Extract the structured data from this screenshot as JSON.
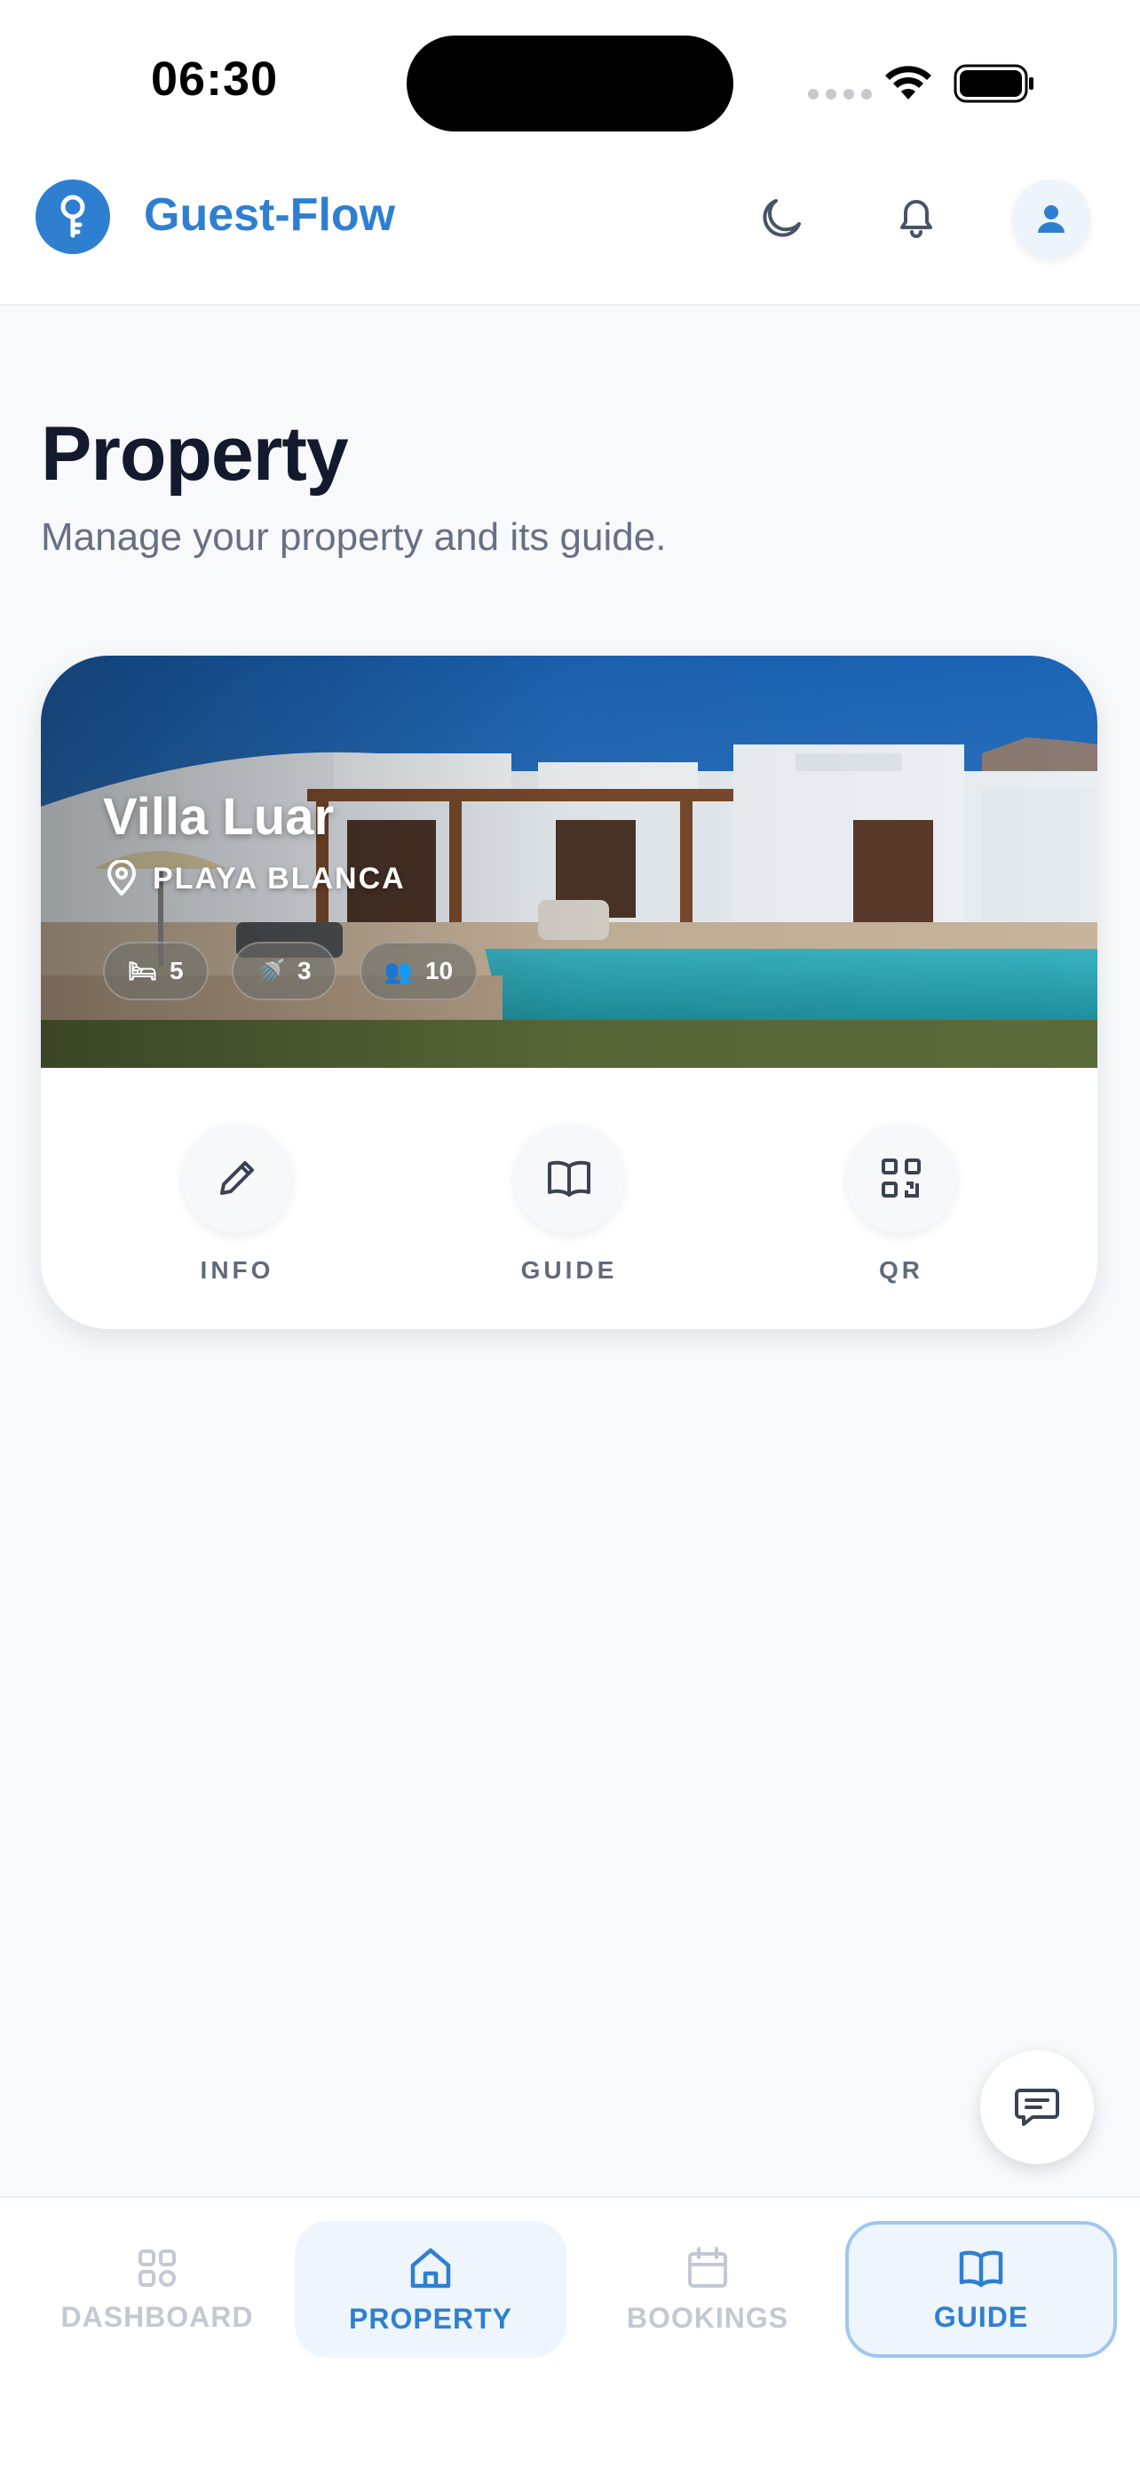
{
  "status_bar": {
    "time": "06:30"
  },
  "header": {
    "brand": "Guest-Flow",
    "logo_icon": "key-icon",
    "icons": [
      "moon-icon",
      "bell-icon",
      "user-icon"
    ],
    "accent_color": "#2f7fd1"
  },
  "page": {
    "title": "Property",
    "subtitle": "Manage your property and its guide."
  },
  "property": {
    "name": "Villa Luar",
    "location": "PLAYA BLANCA",
    "stats": [
      {
        "icon": "bed-icon",
        "value": "5"
      },
      {
        "icon": "shower-icon",
        "value": "3"
      },
      {
        "icon": "guests-icon",
        "value": "10"
      }
    ],
    "actions": [
      {
        "icon": "pencil-icon",
        "label": "INFO"
      },
      {
        "icon": "book-icon",
        "label": "GUIDE"
      },
      {
        "icon": "qr-icon",
        "label": "QR"
      }
    ]
  },
  "fab": {
    "icon": "chat-icon"
  },
  "bottom_nav": {
    "items": [
      {
        "icon": "grid-icon",
        "label": "DASHBOARD",
        "state": "inactive"
      },
      {
        "icon": "home-icon",
        "label": "PROPERTY",
        "state": "active"
      },
      {
        "icon": "calendar-icon",
        "label": "BOOKINGS",
        "state": "inactive"
      },
      {
        "icon": "book-icon",
        "label": "GUIDE",
        "state": "focused"
      }
    ]
  }
}
